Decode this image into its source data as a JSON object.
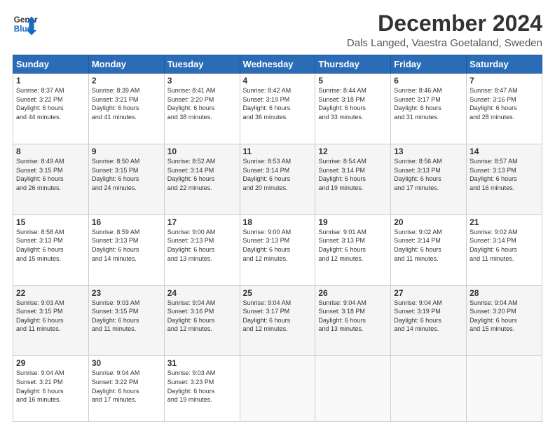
{
  "logo": {
    "line1": "General",
    "line2": "Blue"
  },
  "title": "December 2024",
  "subtitle": "Dals Langed, Vaestra Goetaland, Sweden",
  "days_header": [
    "Sunday",
    "Monday",
    "Tuesday",
    "Wednesday",
    "Thursday",
    "Friday",
    "Saturday"
  ],
  "weeks": [
    [
      {
        "day": "1",
        "info": "Sunrise: 8:37 AM\nSunset: 3:22 PM\nDaylight: 6 hours\nand 44 minutes."
      },
      {
        "day": "2",
        "info": "Sunrise: 8:39 AM\nSunset: 3:21 PM\nDaylight: 6 hours\nand 41 minutes."
      },
      {
        "day": "3",
        "info": "Sunrise: 8:41 AM\nSunset: 3:20 PM\nDaylight: 6 hours\nand 38 minutes."
      },
      {
        "day": "4",
        "info": "Sunrise: 8:42 AM\nSunset: 3:19 PM\nDaylight: 6 hours\nand 36 minutes."
      },
      {
        "day": "5",
        "info": "Sunrise: 8:44 AM\nSunset: 3:18 PM\nDaylight: 6 hours\nand 33 minutes."
      },
      {
        "day": "6",
        "info": "Sunrise: 8:46 AM\nSunset: 3:17 PM\nDaylight: 6 hours\nand 31 minutes."
      },
      {
        "day": "7",
        "info": "Sunrise: 8:47 AM\nSunset: 3:16 PM\nDaylight: 6 hours\nand 28 minutes."
      }
    ],
    [
      {
        "day": "8",
        "info": "Sunrise: 8:49 AM\nSunset: 3:15 PM\nDaylight: 6 hours\nand 26 minutes."
      },
      {
        "day": "9",
        "info": "Sunrise: 8:50 AM\nSunset: 3:15 PM\nDaylight: 6 hours\nand 24 minutes."
      },
      {
        "day": "10",
        "info": "Sunrise: 8:52 AM\nSunset: 3:14 PM\nDaylight: 6 hours\nand 22 minutes."
      },
      {
        "day": "11",
        "info": "Sunrise: 8:53 AM\nSunset: 3:14 PM\nDaylight: 6 hours\nand 20 minutes."
      },
      {
        "day": "12",
        "info": "Sunrise: 8:54 AM\nSunset: 3:14 PM\nDaylight: 6 hours\nand 19 minutes."
      },
      {
        "day": "13",
        "info": "Sunrise: 8:56 AM\nSunset: 3:13 PM\nDaylight: 6 hours\nand 17 minutes."
      },
      {
        "day": "14",
        "info": "Sunrise: 8:57 AM\nSunset: 3:13 PM\nDaylight: 6 hours\nand 16 minutes."
      }
    ],
    [
      {
        "day": "15",
        "info": "Sunrise: 8:58 AM\nSunset: 3:13 PM\nDaylight: 6 hours\nand 15 minutes."
      },
      {
        "day": "16",
        "info": "Sunrise: 8:59 AM\nSunset: 3:13 PM\nDaylight: 6 hours\nand 14 minutes."
      },
      {
        "day": "17",
        "info": "Sunrise: 9:00 AM\nSunset: 3:13 PM\nDaylight: 6 hours\nand 13 minutes."
      },
      {
        "day": "18",
        "info": "Sunrise: 9:00 AM\nSunset: 3:13 PM\nDaylight: 6 hours\nand 12 minutes."
      },
      {
        "day": "19",
        "info": "Sunrise: 9:01 AM\nSunset: 3:13 PM\nDaylight: 6 hours\nand 12 minutes."
      },
      {
        "day": "20",
        "info": "Sunrise: 9:02 AM\nSunset: 3:14 PM\nDaylight: 6 hours\nand 11 minutes."
      },
      {
        "day": "21",
        "info": "Sunrise: 9:02 AM\nSunset: 3:14 PM\nDaylight: 6 hours\nand 11 minutes."
      }
    ],
    [
      {
        "day": "22",
        "info": "Sunrise: 9:03 AM\nSunset: 3:15 PM\nDaylight: 6 hours\nand 11 minutes."
      },
      {
        "day": "23",
        "info": "Sunrise: 9:03 AM\nSunset: 3:15 PM\nDaylight: 6 hours\nand 11 minutes."
      },
      {
        "day": "24",
        "info": "Sunrise: 9:04 AM\nSunset: 3:16 PM\nDaylight: 6 hours\nand 12 minutes."
      },
      {
        "day": "25",
        "info": "Sunrise: 9:04 AM\nSunset: 3:17 PM\nDaylight: 6 hours\nand 12 minutes."
      },
      {
        "day": "26",
        "info": "Sunrise: 9:04 AM\nSunset: 3:18 PM\nDaylight: 6 hours\nand 13 minutes."
      },
      {
        "day": "27",
        "info": "Sunrise: 9:04 AM\nSunset: 3:19 PM\nDaylight: 6 hours\nand 14 minutes."
      },
      {
        "day": "28",
        "info": "Sunrise: 9:04 AM\nSunset: 3:20 PM\nDaylight: 6 hours\nand 15 minutes."
      }
    ],
    [
      {
        "day": "29",
        "info": "Sunrise: 9:04 AM\nSunset: 3:21 PM\nDaylight: 6 hours\nand 16 minutes."
      },
      {
        "day": "30",
        "info": "Sunrise: 9:04 AM\nSunset: 3:22 PM\nDaylight: 6 hours\nand 17 minutes."
      },
      {
        "day": "31",
        "info": "Sunrise: 9:03 AM\nSunset: 3:23 PM\nDaylight: 6 hours\nand 19 minutes."
      },
      {
        "day": "",
        "info": ""
      },
      {
        "day": "",
        "info": ""
      },
      {
        "day": "",
        "info": ""
      },
      {
        "day": "",
        "info": ""
      }
    ]
  ]
}
